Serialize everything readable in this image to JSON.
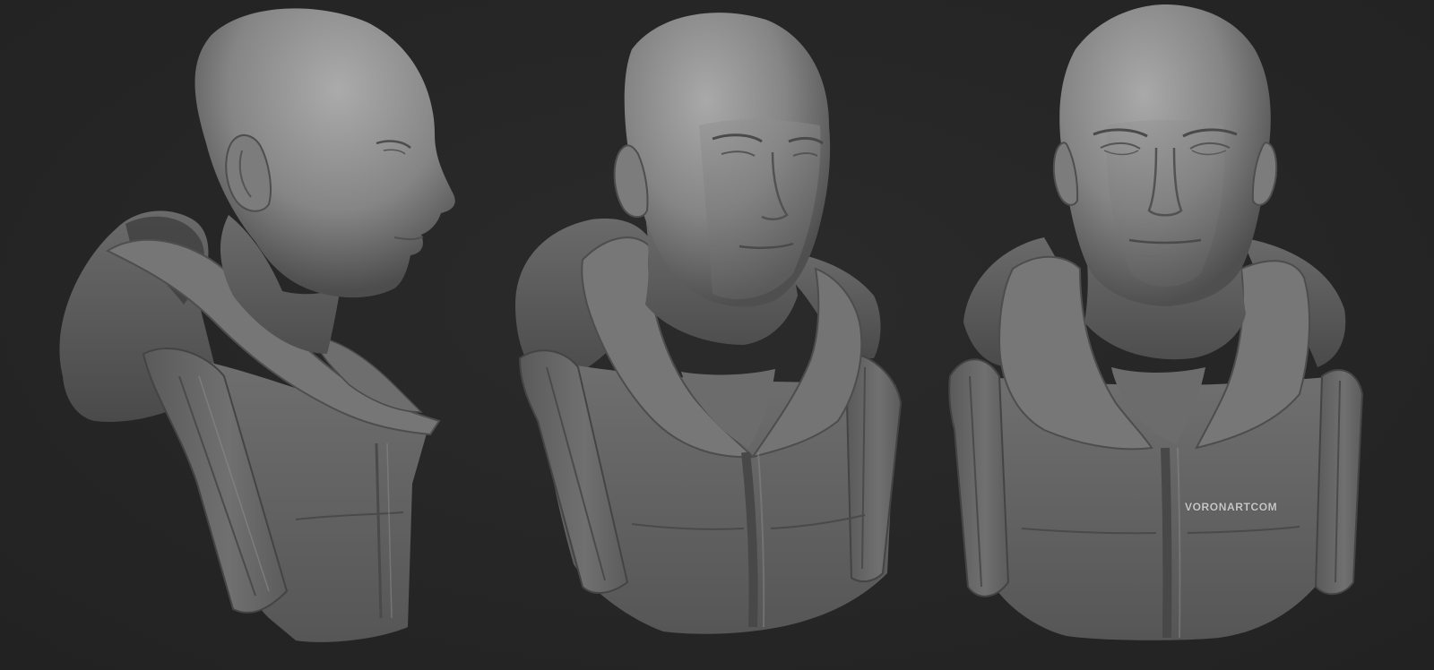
{
  "scene": {
    "background_color": "#262626",
    "clay_color": "#7a7a7a",
    "views": [
      {
        "id": "profile-view",
        "angle": "side"
      },
      {
        "id": "three-quarter-view",
        "angle": "three-quarter"
      },
      {
        "id": "front-view",
        "angle": "front"
      }
    ]
  },
  "watermark": {
    "text": "VORONARTCOM"
  }
}
